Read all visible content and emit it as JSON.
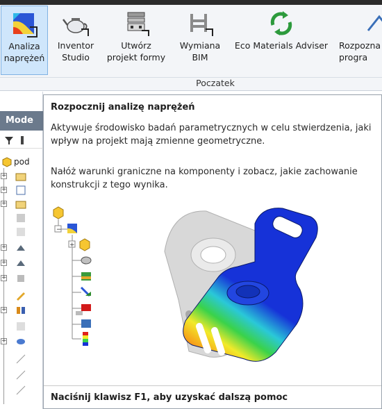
{
  "ribbon": {
    "buttons": [
      {
        "label": "Analiza\nnaprężeń",
        "icon": "stress-analysis-icon",
        "active": true
      },
      {
        "label": "Inventor\nStudio",
        "icon": "teapot-icon",
        "active": false
      },
      {
        "label": "Utwórz\nprojekt formy",
        "icon": "mold-design-icon",
        "active": false
      },
      {
        "label": "Wymiana\nBIM",
        "icon": "bim-exchange-icon",
        "active": false
      },
      {
        "label": "Eco Materials Adviser",
        "icon": "eco-materials-icon",
        "active": false
      },
      {
        "label": "Rozpozna\nprogra",
        "icon": "recognize-program-icon",
        "active": false
      }
    ],
    "group_label": "Poczatek"
  },
  "model_panel": {
    "tab_label": "Mode",
    "root_label": "pod"
  },
  "tooltip": {
    "title": "Rozpocznij analizę naprężeń",
    "description": "Aktywuje środowisko badań parametrycznych w celu stwierdzenia, jaki wpływ na projekt mają zmienne geometryczne.",
    "description2": "Nałóż warunki graniczne na komponenty i zobacz, jakie zachowanie konstrukcji z tego wynika.",
    "footer": "Naciśnij klawisz F1, aby uzyskać dalszą pomoc"
  },
  "colors": {
    "accent_active": "#cfe6fb",
    "panel_tab": "#6b7a8c",
    "stress_blue": "#1632d8"
  }
}
